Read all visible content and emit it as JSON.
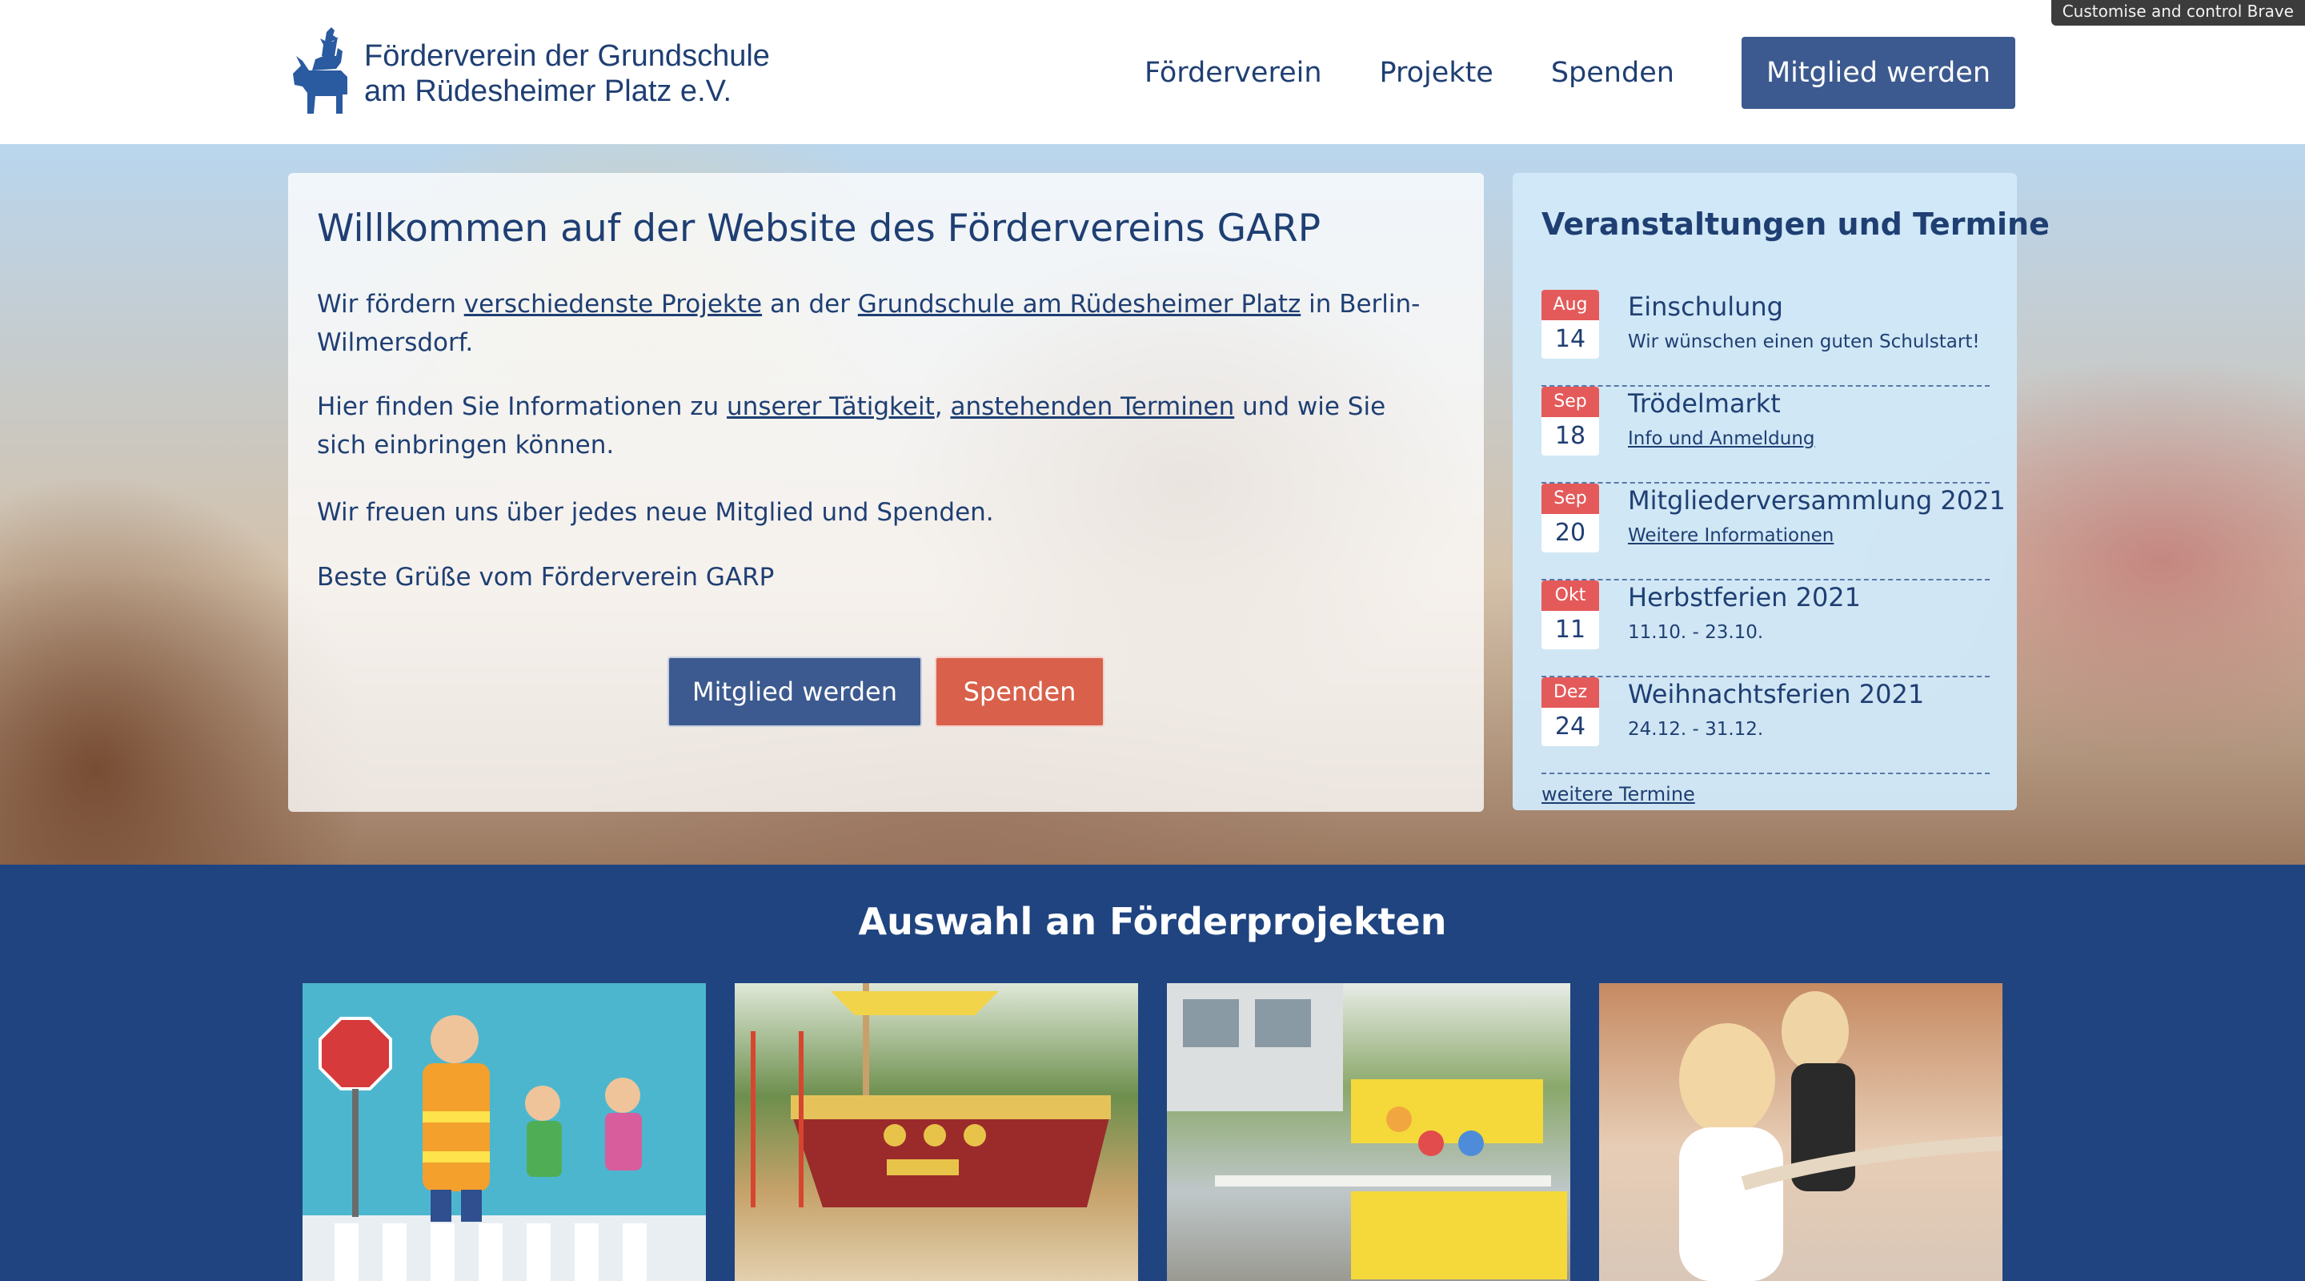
{
  "browser": {
    "tooltip": "Customise and control Brave"
  },
  "header": {
    "brand_line1": "Förderverein der Grundschule",
    "brand_line2": "am Rüdesheimer Platz e.V.",
    "nav": [
      {
        "label": "Förderverein"
      },
      {
        "label": "Projekte"
      },
      {
        "label": "Spenden"
      }
    ],
    "cta_label": "Mitglied werden"
  },
  "hero": {
    "title": "Willkommen auf der Website des Fördervereins GARP",
    "p1_pre": "Wir fördern ",
    "p1_link1": "verschiedenste Projekte",
    "p1_mid": " an der ",
    "p1_link2": "Grundschule am Rüdesheimer Platz",
    "p1_post": " in Berlin-Wilmersdorf.",
    "p2_pre": "Hier finden Sie Informationen zu ",
    "p2_link1": "unserer Tätigkeit",
    "p2_sep": ", ",
    "p2_link2": "anstehenden Terminen",
    "p2_post": " und wie Sie sich einbringen können.",
    "p3": "Wir freuen uns über jedes neue Mitglied und Spenden.",
    "p4": "Beste Grüße vom Förderverein GARP",
    "btn_member": "Mitglied werden",
    "btn_donate": "Spenden"
  },
  "events": {
    "title": "Veranstaltungen und Termine",
    "items": [
      {
        "month": "Aug",
        "day": "14",
        "title": "Einschulung",
        "sub": "Wir wünschen einen guten Schulstart!"
      },
      {
        "month": "Sep",
        "day": "18",
        "title": "Trödelmarkt",
        "sub": "Info und Anmeldung"
      },
      {
        "month": "Sep",
        "day": "20",
        "title": "Mitgliederversammlung 2021",
        "sub": "Weitere Informationen"
      },
      {
        "month": "Okt",
        "day": "11",
        "title": "Herbstferien 2021",
        "sub": "11.10. - 23.10."
      },
      {
        "month": "Dez",
        "day": "24",
        "title": "Weihnachtsferien 2021",
        "sub": "24.12. - 31.12."
      }
    ],
    "more": "weitere Termine"
  },
  "projects": {
    "title": "Auswahl an Förderprojekten"
  },
  "colors": {
    "navy": "#1f3f73",
    "button_blue": "#3c5a8f",
    "accent_red": "#d9604a",
    "date_red": "#e45a5a",
    "section_blue": "#1f4480"
  }
}
